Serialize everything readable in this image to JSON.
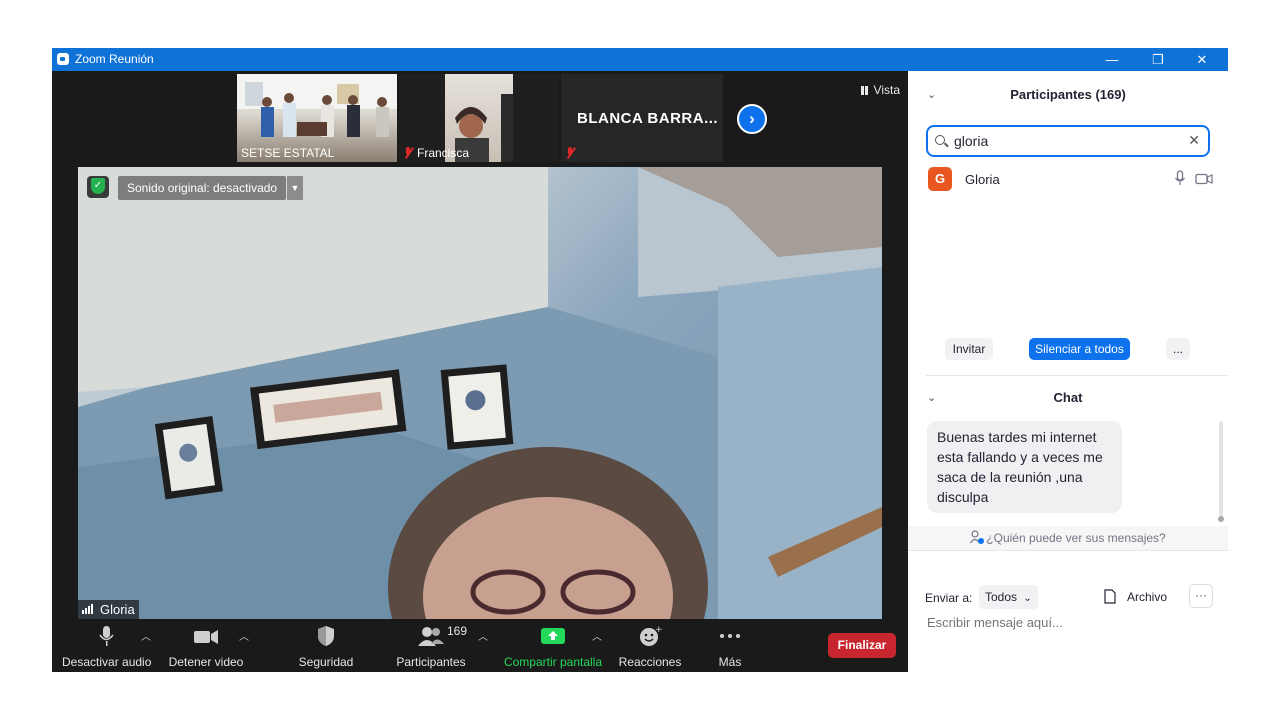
{
  "window": {
    "title": "Zoom Reunión",
    "controls": {
      "minimize": "—",
      "restore": "❐",
      "close": "✕"
    }
  },
  "thumbnails": [
    {
      "name": "SETSE ESTATAL"
    },
    {
      "name": "Francisca"
    },
    {
      "name": ""
    }
  ],
  "featured_tile": {
    "name": "BLANCA BARRA..."
  },
  "view_button": {
    "label": "Vista"
  },
  "main_video": {
    "name": "Gloria",
    "audio_notice": "Sonido original: desactivado"
  },
  "toolbar": {
    "audio": "Desactivar audio",
    "video": "Detener video",
    "security": "Seguridad",
    "participants": "Participantes",
    "participants_count": "169",
    "share": "Compartir pantalla",
    "reactions": "Reacciones",
    "more": "Más",
    "end": "Finalizar",
    "colors": {
      "share": "#23d959",
      "end": "#c8262e"
    }
  },
  "participants_panel": {
    "title": "Participantes (169)",
    "search_value": "gloria",
    "results": [
      {
        "initial": "G",
        "name": "Gloria",
        "avatar_color": "#e8571f"
      }
    ],
    "invite": "Invitar",
    "mute_all": "Silenciar a todos",
    "more": "..."
  },
  "chat_panel": {
    "title": "Chat",
    "messages": [
      {
        "text": "Buenas tardes mi internet esta fallando y a veces me saca de la reunión ,una disculpa"
      }
    ],
    "who_can_see": "¿Quién puede ver sus mensajes?",
    "send_to_label": "Enviar a:",
    "send_to_value": "Todos",
    "file_label": "Archivo",
    "more": "···",
    "input_placeholder": "Escribir mensaje aquí..."
  }
}
